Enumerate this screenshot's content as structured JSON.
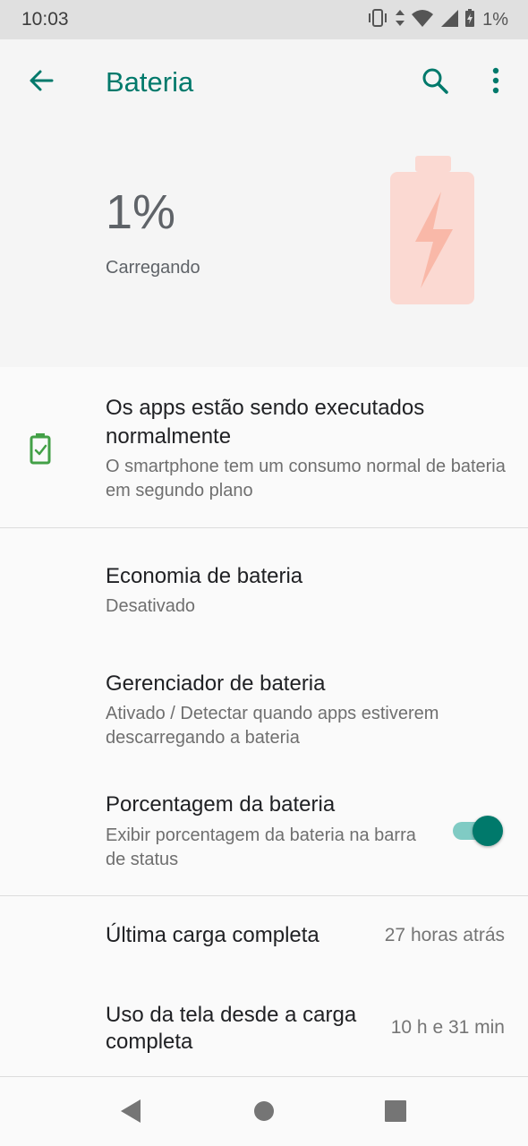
{
  "status_bar": {
    "time": "10:03",
    "battery_text": "1%",
    "icons": [
      "vibrate-icon",
      "data-arrows-icon",
      "wifi-icon",
      "signal-icon",
      "battery-charging-icon"
    ]
  },
  "app_bar": {
    "title": "Bateria",
    "back_icon": "arrow-back-icon",
    "search_icon": "search-icon",
    "more_icon": "more-vert-icon"
  },
  "hero": {
    "percentage": "1%",
    "status": "Carregando",
    "battery_icon": "battery-charging-icon",
    "level_fraction": 0.01
  },
  "tip": {
    "icon": "battery-check-icon",
    "title": "Os apps estão sendo executados normalmente",
    "summary": "O smartphone tem um consumo normal de bateria em segundo plano"
  },
  "preferences": {
    "saver": {
      "title": "Economia de bateria",
      "summary": "Desativado"
    },
    "manager": {
      "title": "Gerenciador de bateria",
      "summary": "Ativado / Detectar quando apps estiverem descarregando a bateria"
    },
    "percentage": {
      "title": "Porcentagem da bateria",
      "summary": "Exibir porcentagem da bateria na barra de status",
      "enabled": true
    }
  },
  "info": {
    "last_full_charge": {
      "title": "Última carga completa",
      "value": "27 horas atrás"
    },
    "screen_usage": {
      "title": "Uso da tela desde a carga completa",
      "value": "10 h e 31 min"
    }
  },
  "nav_bar": {
    "back_icon": "nav-back-icon",
    "home_icon": "nav-home-icon",
    "recents_icon": "nav-recents-icon"
  },
  "colors": {
    "accent": "#00796b",
    "switch_track": "#80cbc4",
    "battery_hero_fill": "#fbd9d2",
    "battery_hero_bolt": "#f9b8a8",
    "tip_icon": "#43a047"
  }
}
